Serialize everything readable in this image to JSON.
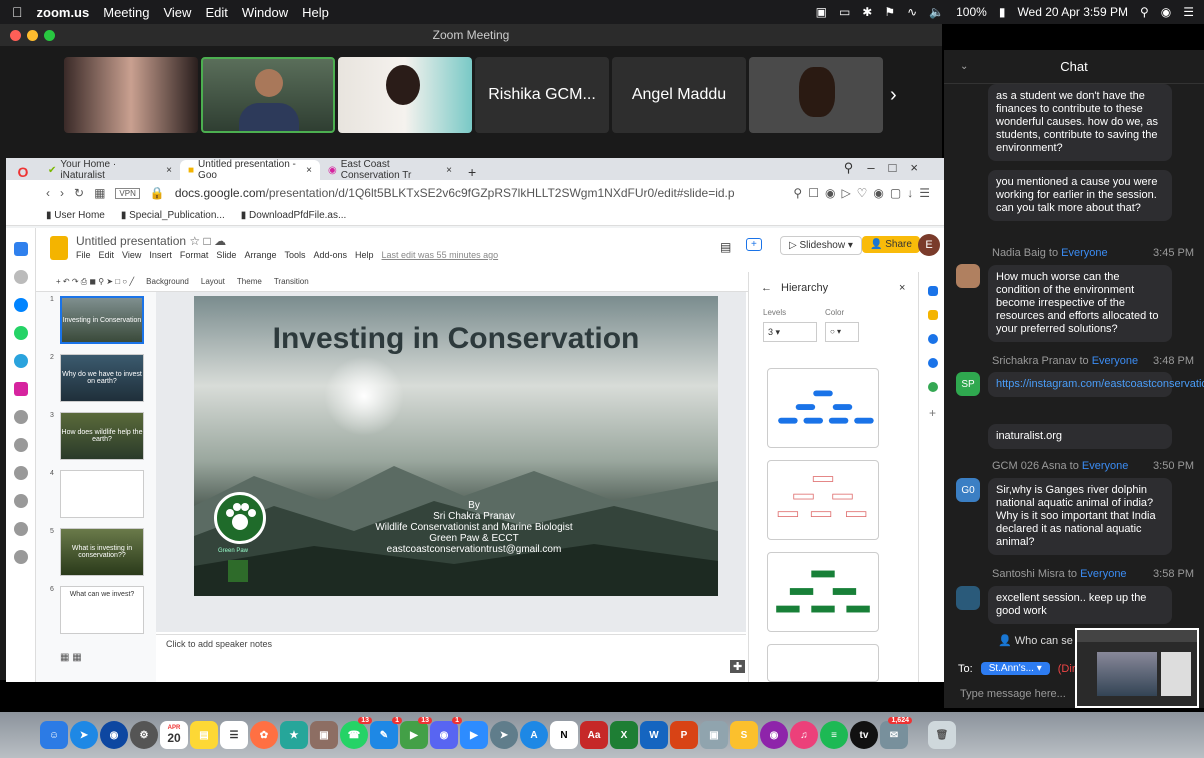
{
  "menubar": {
    "app": "zoom.us",
    "menus": [
      "Meeting",
      "View",
      "Edit",
      "Window",
      "Help"
    ],
    "battery": "100%",
    "datetime": "Wed 20 Apr  3:59 PM"
  },
  "window": {
    "title": "Zoom Meeting"
  },
  "participants": [
    {
      "name": ""
    },
    {
      "name": ""
    },
    {
      "name": ""
    },
    {
      "name": "Rishika GCM..."
    },
    {
      "name": "Angel Maddu"
    },
    {
      "name": ""
    }
  ],
  "browser": {
    "tabs": [
      "Your Home · iNaturalist",
      "Untitled presentation - Goo",
      "East Coast Conservation Tr"
    ],
    "url_host": "docs.google.com",
    "url_path": "/presentation/d/1Q6lt5BLKTxSE2v6c9fGZpRS7lkHLLT2SWgm1NXdFUr0/edit#slide=id.p",
    "bookmarks": [
      "User Home",
      "Special_Publication...",
      "DownloadPfdFile.as..."
    ],
    "vpn": "VPN"
  },
  "slides_app": {
    "doc_title": "Untitled presentation",
    "menus": [
      "File",
      "Edit",
      "View",
      "Insert",
      "Format",
      "Slide",
      "Arrange",
      "Tools",
      "Add-ons",
      "Help"
    ],
    "last_edit": "Last edit was 55 minutes ago",
    "slideshow": "Slideshow",
    "share": "Share",
    "avatar": "E",
    "toolbar": [
      "Background",
      "Layout",
      "Theme",
      "Transition"
    ],
    "notes_placeholder": "Click to add speaker notes",
    "thumbs": [
      {
        "n": "1",
        "text": "Investing in Conservation"
      },
      {
        "n": "2",
        "text": "Why do we have to invest on earth?"
      },
      {
        "n": "3",
        "text": "How does wildlife help the earth?"
      },
      {
        "n": "4",
        "text": ""
      },
      {
        "n": "5",
        "text": "What is investing in conservation??"
      },
      {
        "n": "6",
        "text": "What can we invest?"
      }
    ],
    "slide": {
      "title": "Investing in Conservation",
      "by": "By",
      "author": "Sri Chakra Pranav",
      "role": "Wildlife Conservationist and Marine Biologist",
      "org": "Green Paw & ECCT",
      "email": "eastcoastconservationtrust@gmail.com",
      "logo_text": "Green Paw"
    },
    "panel": {
      "title": "Hierarchy",
      "levels_label": "Levels",
      "color_label": "Color",
      "levels_value": "3"
    }
  },
  "chat": {
    "title": "Chat",
    "messages": [
      {
        "text": "as a student we don't have the finances to contribute to these wonderful causes. how do we, as students, contribute to saving the environment?"
      },
      {
        "text": "you mentioned a cause you were working for earlier in the session. can you talk more about that?"
      },
      {
        "sender": "Nadia Baig",
        "to": "Everyone",
        "time": "3:45 PM",
        "text": "How much worse can the condition of the environment become irrespective of the resources and efforts allocated to your preferred solutions?"
      },
      {
        "sender": "Srichakra Pranav",
        "to": "Everyone",
        "time": "3:48 PM",
        "avatar": "SP",
        "text": "https://instagram.com/eastcoastconservationteam"
      },
      {
        "text": "inaturalist.org"
      },
      {
        "sender": "GCM 026 Asna",
        "to": "Everyone",
        "time": "3:50 PM",
        "avatar": "G0",
        "text": "Sir,why is Ganges river dolphin national aquatic animal of india? Why is it soo important that India declared it as national aquatic animal?"
      },
      {
        "sender": "Santoshi Misra",
        "to": "Everyone",
        "time": "3:58 PM",
        "text": "excellent session.. keep up the good work"
      }
    ],
    "conj": "to",
    "who": "Who can se",
    "to_label": "To:",
    "to_value": "St.Ann's...",
    "to_extra": "(Dire",
    "placeholder": "Type message here..."
  },
  "dock": {
    "calendar_month": "APR",
    "calendar_day": "20",
    "badges": [
      "13",
      "1",
      "13",
      "1",
      "1,624"
    ]
  }
}
